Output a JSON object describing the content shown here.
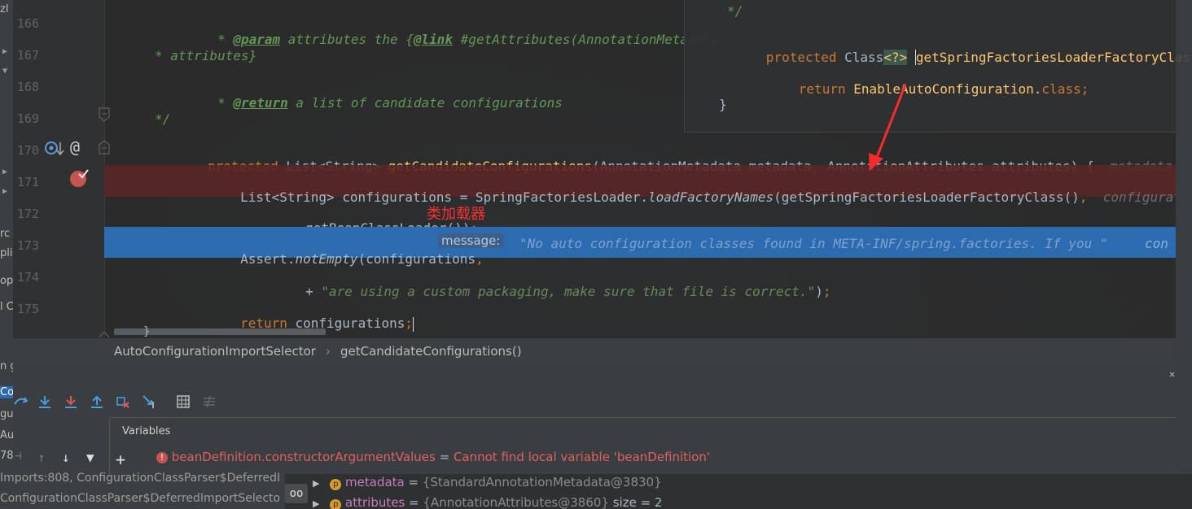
{
  "left_panel": {
    "top_label": "zl",
    "items": [
      "rc",
      "pli",
      "opi",
      "l C",
      "n g",
      "Co",
      "gu",
      "Au",
      "78,",
      "Au"
    ]
  },
  "editor": {
    "lines": [
      {
        "no": "166",
        "segments": [
          {
            "t": "* ",
            "c": "doc"
          },
          {
            "t": "@param",
            "c": "tag"
          },
          {
            "t": " attributes the {",
            "c": "doc"
          },
          {
            "t": "@link",
            "c": "tag"
          },
          {
            "t": " #getAttributes(AnnotationMetadata",
            "c": "doc"
          }
        ]
      },
      {
        "no": "167",
        "segments": [
          {
            "t": "* attributes}",
            "c": "doc"
          }
        ]
      },
      {
        "no": "168",
        "segments": [
          {
            "t": "* ",
            "c": "doc"
          },
          {
            "t": "@return",
            "c": "tag"
          },
          {
            "t": " a list of candidate configurations",
            "c": "doc"
          }
        ]
      },
      {
        "no": "169",
        "segments": [
          {
            "t": "*/",
            "c": "doc"
          }
        ]
      },
      {
        "no": "170",
        "segments": [
          {
            "t": "protected ",
            "c": "kw"
          },
          {
            "t": "List<String> ",
            "c": "pl"
          },
          {
            "t": "getCandidateConfigurations",
            "c": "fn"
          },
          {
            "t": "(AnnotationMetadata metadata",
            "c": "pl"
          },
          {
            "t": ", ",
            "c": "kw"
          },
          {
            "t": "AnnotationAttributes attributes) {  ",
            "c": "pl"
          },
          {
            "t": "metadata: S",
            "c": "hint"
          }
        ]
      },
      {
        "no": "171",
        "segments": [
          {
            "t": "List<String> configurations = SpringFactoriesLoader.",
            "c": "pl"
          },
          {
            "t": "loadFactoryNames",
            "c": "sm"
          },
          {
            "t": "(getSpringFactoriesLoaderFactoryClass()",
            "c": "pl"
          },
          {
            "t": ",  ",
            "c": "kw"
          },
          {
            "t": "configuration",
            "c": "hint"
          }
        ]
      },
      {
        "no": "172",
        "segments": [
          {
            "t": "getBeanClassLoader())",
            "c": "pl"
          },
          {
            "t": ";",
            "c": "kw"
          }
        ]
      },
      {
        "no": "173",
        "segments": [
          {
            "t": "Assert.",
            "c": "pl"
          },
          {
            "t": "notEmpty",
            "c": "sm"
          },
          {
            "t": "(configurations",
            "c": "pl"
          },
          {
            "t": ",  ",
            "c": "kw"
          }
        ]
      },
      {
        "no": "174",
        "segments": [
          {
            "t": "+ ",
            "c": "pl"
          },
          {
            "t": "\"are using a custom packaging, make sure that file is correct.\"",
            "c": "st"
          },
          {
            "t": ")",
            "c": "pl"
          },
          {
            "t": ";",
            "c": "kw"
          }
        ]
      },
      {
        "no": "175",
        "segments": [
          {
            "t": "return ",
            "c": "kw"
          },
          {
            "t": "configurations",
            "c": "pl"
          },
          {
            "t": ";",
            "c": "kw"
          }
        ]
      }
    ],
    "param_hint": "message:",
    "line173_string": "\"No auto configuration classes found in META-INF/spring.factories. If you \"",
    "line173_tail": "con",
    "annotation_cn": "类加载器",
    "closing_brace": "}"
  },
  "popup": {
    "lines": [
      {
        "segments": [
          {
            "t": "*/",
            "c": "doc"
          }
        ]
      },
      {
        "segments": [
          {
            "t": "protected ",
            "c": "kw"
          },
          {
            "t": "Class",
            "c": "pl"
          },
          {
            "t": "<?>",
            "c": "fn"
          },
          {
            "t": " ",
            "c": "pl"
          },
          {
            "t": "getSpringFactoriesLoaderFactoryClass",
            "c": "fn"
          },
          {
            "t": "()",
            "c": "pl"
          }
        ]
      },
      {
        "segments": [
          {
            "t": "return ",
            "c": "kw"
          },
          {
            "t": "EnableAutoConfiguration.",
            "c": "fn"
          },
          {
            "t": "class",
            "c": "kw"
          },
          {
            "t": ";",
            "c": "kw"
          }
        ]
      },
      {
        "segments": [
          {
            "t": "}",
            "c": "pl"
          }
        ]
      }
    ]
  },
  "breadcrumb": {
    "class_name": "AutoConfigurationImportSelector",
    "separator": "›",
    "method_name": "getCandidateConfigurations()"
  },
  "debug": {
    "variables_title": "Variables",
    "vars": [
      {
        "name": "beanDefinition.constructorArgumentValues",
        "eq": " = ",
        "value": "Cannot find local variable 'beanDefinition'"
      },
      {
        "name": "metadata",
        "eq": " = ",
        "value": "{StandardAnnotationMetadata@3830}"
      },
      {
        "name": "attributes",
        "eq": " = ",
        "value": "{AnnotationAttributes@3860}",
        "extra": " size = 2"
      }
    ],
    "frames": [
      "Imports:808, ConfigurationClassParser$DeferredI",
      "ConfigurationClassParser$DeferredImportSelecto"
    ]
  },
  "colors": {
    "keyword": "#cc7832",
    "function": "#ffc66d",
    "doc_comment": "#629755",
    "string": "#6a8759",
    "selection": "#2d6bb0",
    "error_row": "#5a2626",
    "annotation_red": "#ff3030"
  }
}
